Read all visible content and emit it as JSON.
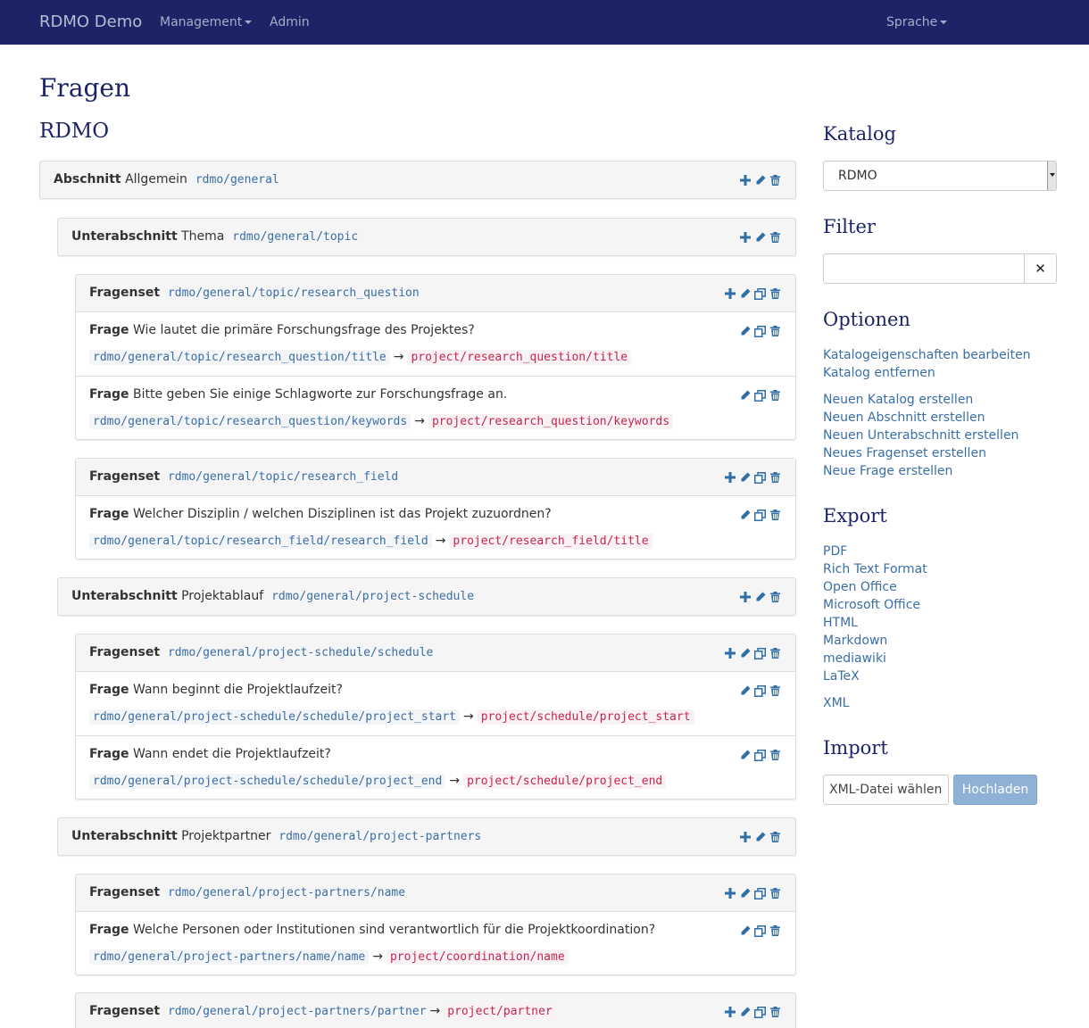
{
  "navbar": {
    "brand": "RDMO Demo",
    "management": "Management",
    "admin": "Admin",
    "language": "Sprache"
  },
  "page_title": "Fragen",
  "catalog_title": "RDMO",
  "sections": [
    {
      "type": "Abschnitt",
      "name": "Allgemein",
      "uri": "rdmo/general"
    },
    {
      "type": "Unterabschnitt",
      "name": "Thema",
      "uri": "rdmo/general/topic"
    },
    {
      "type": "Unterabschnitt",
      "name": "Projektablauf",
      "uri": "rdmo/general/project-schedule"
    },
    {
      "type": "Unterabschnitt",
      "name": "Projektpartner",
      "uri": "rdmo/general/project-partners"
    }
  ],
  "questionsets": [
    {
      "type": "Fragenset",
      "uri": "rdmo/general/topic/research_question",
      "questions": [
        {
          "type": "Frage",
          "text": "Wie lautet die primäre Forschungsfrage des Projektes?",
          "uri": "rdmo/general/topic/research_question/title",
          "attribute": "project/research_question/title"
        },
        {
          "type": "Frage",
          "text": "Bitte geben Sie einige Schlagworte zur Forschungsfrage an.",
          "uri": "rdmo/general/topic/research_question/keywords",
          "attribute": "project/research_question/keywords"
        }
      ]
    },
    {
      "type": "Fragenset",
      "uri": "rdmo/general/topic/research_field",
      "questions": [
        {
          "type": "Frage",
          "text": "Welcher Disziplin / welchen Disziplinen ist das Projekt zuzuordnen?",
          "uri": "rdmo/general/topic/research_field/research_field",
          "attribute": "project/research_field/title"
        }
      ]
    },
    {
      "type": "Fragenset",
      "uri": "rdmo/general/project-schedule/schedule",
      "questions": [
        {
          "type": "Frage",
          "text": "Wann beginnt die Projektlaufzeit?",
          "uri": "rdmo/general/project-schedule/schedule/project_start",
          "attribute": "project/schedule/project_start"
        },
        {
          "type": "Frage",
          "text": "Wann endet die Projektlaufzeit?",
          "uri": "rdmo/general/project-schedule/schedule/project_end",
          "attribute": "project/schedule/project_end"
        }
      ]
    },
    {
      "type": "Fragenset",
      "uri": "rdmo/general/project-partners/name",
      "questions": [
        {
          "type": "Frage",
          "text": "Welche Personen oder Institutionen sind verantwortlich für die Projektkoordination?",
          "uri": "rdmo/general/project-partners/name/name",
          "attribute": "project/coordination/name"
        }
      ]
    },
    {
      "type": "Fragenset",
      "uri": "rdmo/general/project-partners/partner",
      "attribute": "project/partner",
      "questions": []
    }
  ],
  "sidebar": {
    "catalog_heading": "Katalog",
    "catalog_selected": "RDMO",
    "filter_heading": "Filter",
    "filter_value": "",
    "options_heading": "Optionen",
    "options_links_1": [
      "Katalogeigenschaften bearbeiten",
      "Katalog entfernen"
    ],
    "options_links_2": [
      "Neuen Katalog erstellen",
      "Neuen Abschnitt erstellen",
      "Neuen Unterabschnitt erstellen",
      "Neues Fragenset erstellen",
      "Neue Frage erstellen"
    ],
    "export_heading": "Export",
    "export_links": [
      "PDF",
      "Rich Text Format",
      "Open Office",
      "Microsoft Office",
      "HTML",
      "Markdown",
      "mediawiki",
      "LaTeX"
    ],
    "export_xml": "XML",
    "import_heading": "Import",
    "file_input": "XML-Datei wählen",
    "upload_button": "Hochladen"
  }
}
